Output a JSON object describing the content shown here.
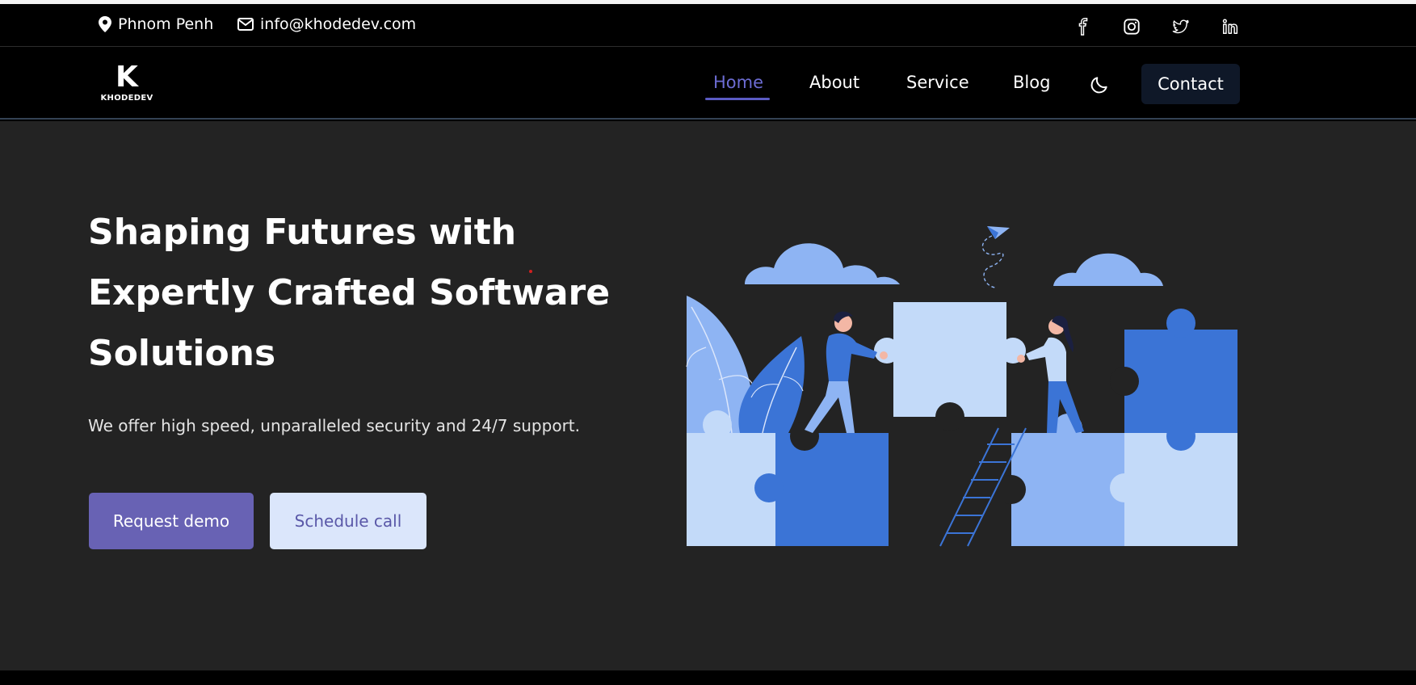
{
  "topbar": {
    "location": "Phnom Penh",
    "email": "info@khodedev.com",
    "social": [
      "facebook-icon",
      "instagram-icon",
      "twitter-icon",
      "linkedin-icon"
    ]
  },
  "nav": {
    "logo_mark": "K",
    "logo_text": "KHODEDEV",
    "links": [
      "Home",
      "About",
      "Service",
      "Blog"
    ],
    "active": "Home",
    "contact_label": "Contact"
  },
  "hero": {
    "title_line1": "Shaping Futures with",
    "title_line2": "Expertly Crafted Software",
    "title_line3": "Solutions",
    "subtitle": "We offer high speed, unparalleled security and 24/7 support.",
    "primary_button": "Request demo",
    "secondary_button": "Schedule call"
  },
  "colors": {
    "accent": "#6862b4",
    "nav_active": "#6c6cd3",
    "hero_bg": "#232323",
    "secondary_button_bg": "#dbe6fb",
    "puzzle_dark": "#3b74d6",
    "puzzle_mid": "#8eb4f3",
    "puzzle_light": "#c3daf9"
  }
}
